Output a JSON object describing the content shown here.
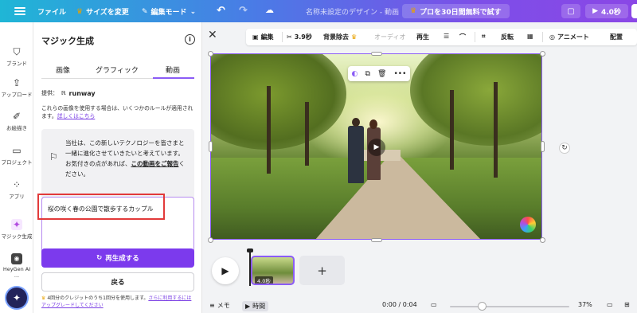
{
  "topbar": {
    "file": "ファイル",
    "resize": "サイズを変更",
    "edit_mode": "編集モード",
    "doc_title": "名称未設定のデザイン - 動画",
    "trial": "プロを30日間無料で試す",
    "play_time": "4.0秒"
  },
  "rail": {
    "items": [
      {
        "label": "ブランド",
        "icon": "brand-icon"
      },
      {
        "label": "アップロード",
        "icon": "upload-icon"
      },
      {
        "label": "お絵描き",
        "icon": "draw-icon"
      },
      {
        "label": "プロジェクト",
        "icon": "folder-icon"
      },
      {
        "label": "アプリ",
        "icon": "apps-icon"
      },
      {
        "label": "マジック生成",
        "icon": "magic-generate-icon"
      },
      {
        "label": "HeyGen AI ...",
        "icon": "heygen-icon"
      }
    ]
  },
  "panel": {
    "title": "マジック生成",
    "tabs": [
      "画像",
      "グラフィック",
      "動画"
    ],
    "active_tab": "動画",
    "provider_label": "提供：",
    "provider_name": "runway",
    "notice": "これらの画像を使用する場合は、いくつかのルールが適用されます。",
    "notice_link": "詳しくはこちら",
    "feedback_text": "当社は、この新しいテクノロジーを皆さまと一緒に進化させていきたいと考えています。お気付きの点があれば、",
    "feedback_link": "この動画をご報告",
    "feedback_tail": "ください。",
    "prompt": "桜の咲く春の公園で散歩するカップル",
    "regenerate": "再生成する",
    "back": "戻る",
    "credit_text": "4回分のクレジットのうち1回分を使用します。",
    "credit_link": "さらに利用するにはアップグレードしてください"
  },
  "toolbar": {
    "edit": "編集",
    "duration": "3.9秒",
    "bg_remove": "背景除去",
    "audio": "オーディオ",
    "playback": "再生",
    "flip": "反転",
    "animate": "アニメート",
    "arrange": "配置"
  },
  "timeline": {
    "clip_duration": "4.0秒"
  },
  "bottombar": {
    "notes": "メモ",
    "time": "時間",
    "timecode": "0:00 / 0:04",
    "zoom": "37%"
  },
  "colors": {
    "accent": "#8b5cf6",
    "button": "#7c3aed",
    "highlight": "#e23a3a"
  }
}
